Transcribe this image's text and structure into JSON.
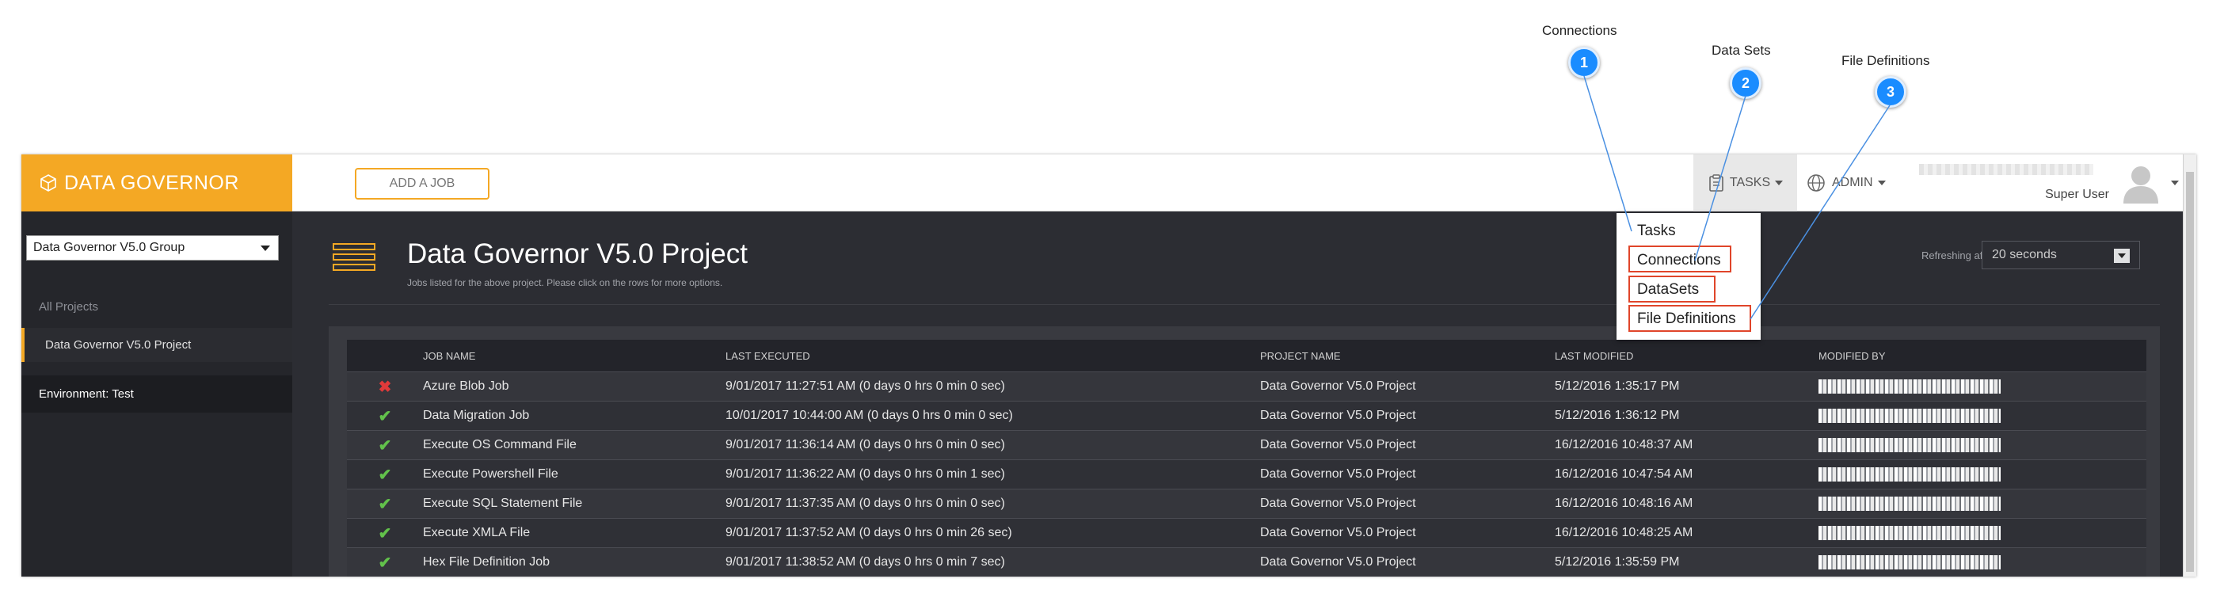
{
  "app": {
    "brand": "DATA GOVERNOR",
    "add_job_label": "ADD A JOB",
    "tasks_label": "TASKS",
    "admin_label": "ADMIN",
    "user_role": "Super User"
  },
  "sidebar": {
    "group_select": "Data Governor V5.0 Group",
    "all_projects_label": "All Projects",
    "project_item": "Data Governor V5.0 Project",
    "environment": "Environment: Test"
  },
  "main": {
    "title": "Data Governor V5.0 Project",
    "subtitle": "Jobs listed for the above project. Please click on the rows for more options.",
    "refresh_label": "Refreshing after",
    "refresh_value": "20 seconds"
  },
  "table": {
    "headers": [
      "JOB NAME",
      "LAST EXECUTED",
      "PROJECT NAME",
      "LAST MODIFIED",
      "MODIFIED BY"
    ],
    "rows": [
      {
        "status": "✖",
        "name": "Azure Blob Job",
        "last_executed": "9/01/2017 11:27:51 AM (0 days 0 hrs 0 min 0 sec)",
        "project": "Data Governor V5.0 Project",
        "modified": "5/12/2016 1:35:17 PM"
      },
      {
        "status": "✔",
        "name": "Data Migration Job",
        "last_executed": "10/01/2017 10:44:00 AM (0 days 0 hrs 0 min 0 sec)",
        "project": "Data Governor V5.0 Project",
        "modified": "5/12/2016 1:36:12 PM"
      },
      {
        "status": "✔",
        "name": "Execute OS Command File",
        "last_executed": "9/01/2017 11:36:14 AM (0 days 0 hrs 0 min 0 sec)",
        "project": "Data Governor V5.0 Project",
        "modified": "16/12/2016 10:48:37 AM"
      },
      {
        "status": "✔",
        "name": "Execute Powershell File",
        "last_executed": "9/01/2017 11:36:22 AM (0 days 0 hrs 0 min 1 sec)",
        "project": "Data Governor V5.0 Project",
        "modified": "16/12/2016 10:47:54 AM"
      },
      {
        "status": "✔",
        "name": "Execute SQL Statement File",
        "last_executed": "9/01/2017 11:37:35 AM (0 days 0 hrs 0 min 0 sec)",
        "project": "Data Governor V5.0 Project",
        "modified": "16/12/2016 10:48:16 AM"
      },
      {
        "status": "✔",
        "name": "Execute XMLA File",
        "last_executed": "9/01/2017 11:37:52 AM (0 days 0 hrs 0 min 26 sec)",
        "project": "Data Governor V5.0 Project",
        "modified": "16/12/2016 10:48:25 AM"
      },
      {
        "status": "✔",
        "name": "Hex File Definition Job",
        "last_executed": "9/01/2017 11:38:52 AM (0 days 0 hrs 0 min 7 sec)",
        "project": "Data Governor V5.0 Project",
        "modified": "5/12/2016 1:35:59 PM"
      }
    ]
  },
  "tasks_dropdown": {
    "items": [
      "Tasks",
      "Connections",
      "DataSets",
      "File Definitions"
    ]
  },
  "callouts": [
    {
      "number": "1",
      "label": "Connections"
    },
    {
      "number": "2",
      "label": "Data Sets"
    },
    {
      "number": "3",
      "label": "File Definitions"
    }
  ],
  "colors": {
    "brand": "#f4a824",
    "success": "#62c14b",
    "error": "#e03a3a",
    "callout": "#1a8cff",
    "highlight": "#e0452a"
  },
  "icons": {
    "brand": "cube-icon",
    "tasks": "clipboard-icon",
    "admin": "globe-icon",
    "user": "avatar-icon",
    "success": "check-icon",
    "error": "cross-icon"
  }
}
